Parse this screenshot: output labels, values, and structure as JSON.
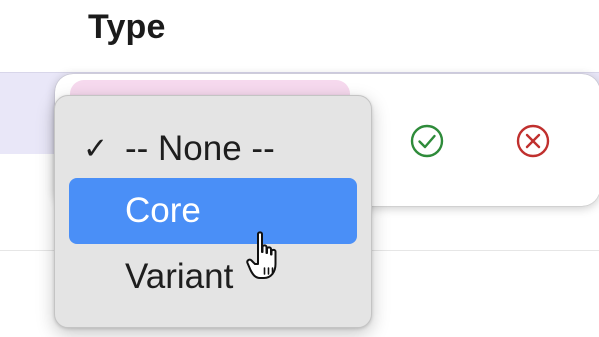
{
  "column": {
    "header": "Type"
  },
  "editor": {
    "confirm_icon": "check-circle-icon",
    "cancel_icon": "x-circle-icon",
    "confirm_color": "#2e8b3a",
    "cancel_color": "#c0302e"
  },
  "dropdown": {
    "selected_index": 0,
    "highlighted_index": 1,
    "checkmark": "✓",
    "items": [
      {
        "label": "-- None --"
      },
      {
        "label": "Core"
      },
      {
        "label": "Variant"
      }
    ],
    "highlight_color": "#4a8ff7"
  },
  "cursor": {
    "icon": "pointing-hand-cursor-icon"
  }
}
